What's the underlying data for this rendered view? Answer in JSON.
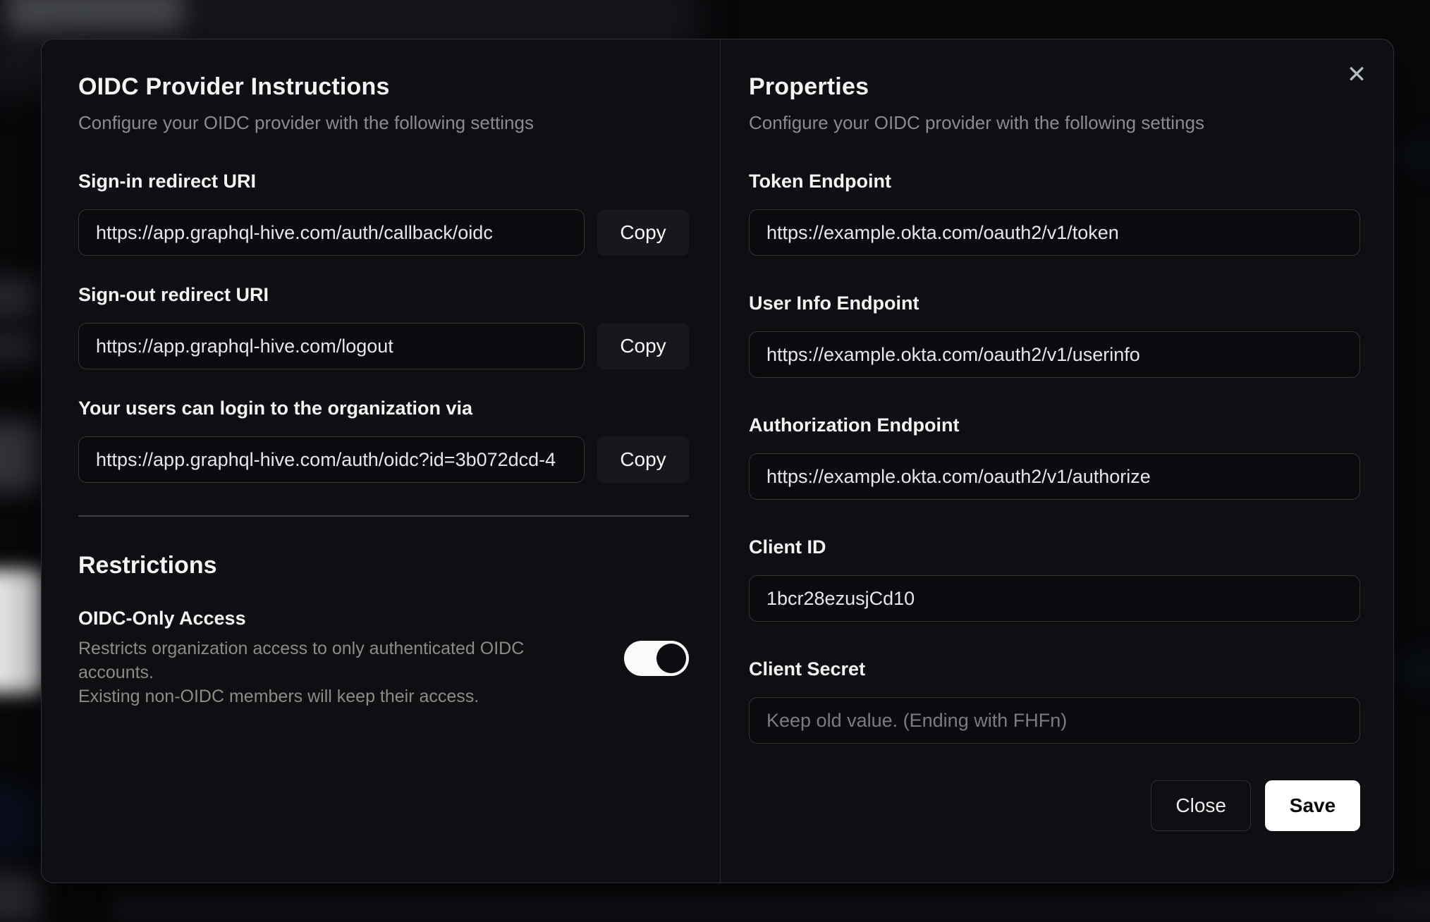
{
  "modal": {
    "close_icon": "✕",
    "left": {
      "title": "OIDC Provider Instructions",
      "subtitle": "Configure your OIDC provider with the following settings",
      "fields": [
        {
          "label": "Sign-in redirect URI",
          "value": "https://app.graphql-hive.com/auth/callback/oidc",
          "copy_label": "Copy"
        },
        {
          "label": "Sign-out redirect URI",
          "value": "https://app.graphql-hive.com/logout",
          "copy_label": "Copy"
        },
        {
          "label": "Your users can login to the organization via",
          "value": "https://app.graphql-hive.com/auth/oidc?id=3b072dcd-4",
          "copy_label": "Copy"
        }
      ],
      "restrictions": {
        "title": "Restrictions",
        "toggle_label": "OIDC-Only Access",
        "description_line1": "Restricts organization access to only authenticated OIDC accounts.",
        "description_line2": "Existing non-OIDC members will keep their access.",
        "toggle_state": "on"
      }
    },
    "right": {
      "title": "Properties",
      "subtitle": "Configure your OIDC provider with the following settings",
      "fields": [
        {
          "label": "Token Endpoint",
          "value": "https://example.okta.com/oauth2/v1/token"
        },
        {
          "label": "User Info Endpoint",
          "value": "https://example.okta.com/oauth2/v1/userinfo"
        },
        {
          "label": "Authorization Endpoint",
          "value": "https://example.okta.com/oauth2/v1/authorize"
        },
        {
          "label": "Client ID",
          "value": "1bcr28ezusjCd10"
        },
        {
          "label": "Client Secret",
          "value": "",
          "placeholder": "Keep old value. (Ending with FHFn)"
        }
      ],
      "buttons": {
        "close": "Close",
        "save": "Save"
      }
    }
  },
  "colors": {
    "backdrop": "#07080a",
    "modal_bg": "#0e0f12",
    "input_border": "#36322b",
    "accent_button_bg": "#ffffff",
    "accent_button_text": "#09090b",
    "toggle_on_track": "#fafafa",
    "toggle_on_knob": "#0c0d10"
  }
}
